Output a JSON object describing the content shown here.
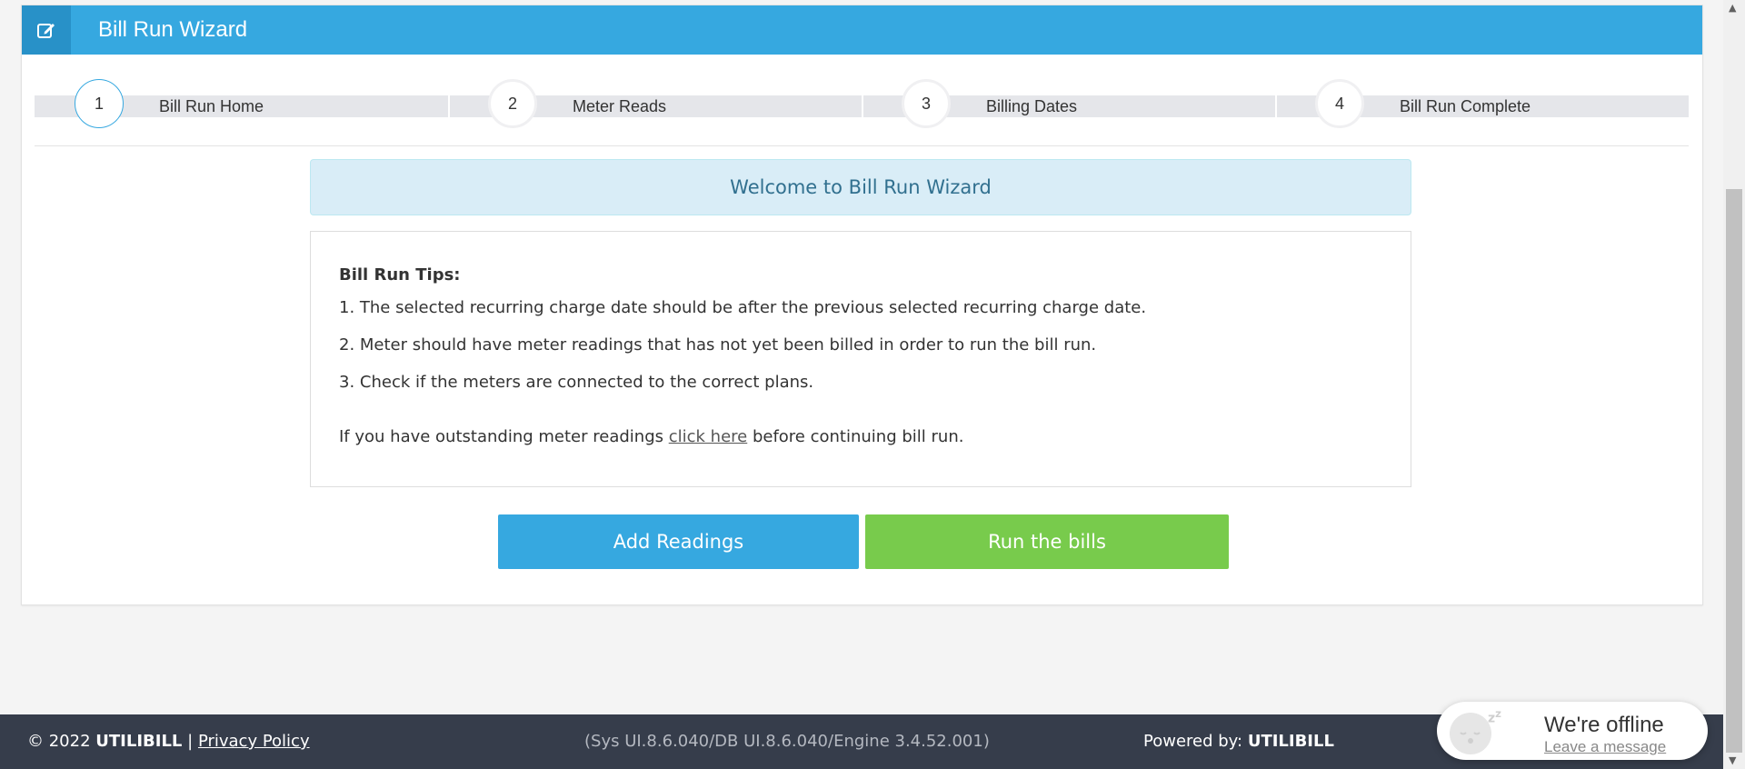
{
  "header": {
    "title": "Bill Run Wizard",
    "icon": "edit-icon"
  },
  "steps": [
    {
      "number": "1",
      "label": "Bill Run Home",
      "active": true
    },
    {
      "number": "2",
      "label": "Meter Reads",
      "active": false
    },
    {
      "number": "3",
      "label": "Billing Dates",
      "active": false
    },
    {
      "number": "4",
      "label": "Bill Run Complete",
      "active": false
    }
  ],
  "welcome": "Welcome to Bill Run Wizard",
  "tips": {
    "title": "Bill Run Tips:",
    "items": [
      "1. The selected recurring charge date should be after the previous selected recurring charge date.",
      "2. Meter should have meter readings that has not yet been billed in order to run the bill run.",
      "3. Check if the meters are connected to the correct plans."
    ],
    "outstanding_before": "If you have outstanding meter readings ",
    "outstanding_link": "click here",
    "outstanding_after": " before continuing bill run."
  },
  "buttons": {
    "add_readings": "Add Readings",
    "run_bills": "Run the bills"
  },
  "colors": {
    "header": "#36a8e0",
    "add_button": "#36a8e0",
    "run_button": "#78cb4c",
    "footer": "#363d4b"
  },
  "footer": {
    "copyright": "© 2022",
    "brand": "UTILIBILL",
    "separator": "|",
    "privacy": "Privacy Policy",
    "version": "(Sys UI.8.6.040/DB UI.8.6.040/Engine 3.4.52.001)",
    "powered_label": "Powered by:",
    "powered_brand": "UTILIBILL"
  },
  "chat_widget": {
    "status": "We're offline",
    "action": "Leave a message"
  }
}
